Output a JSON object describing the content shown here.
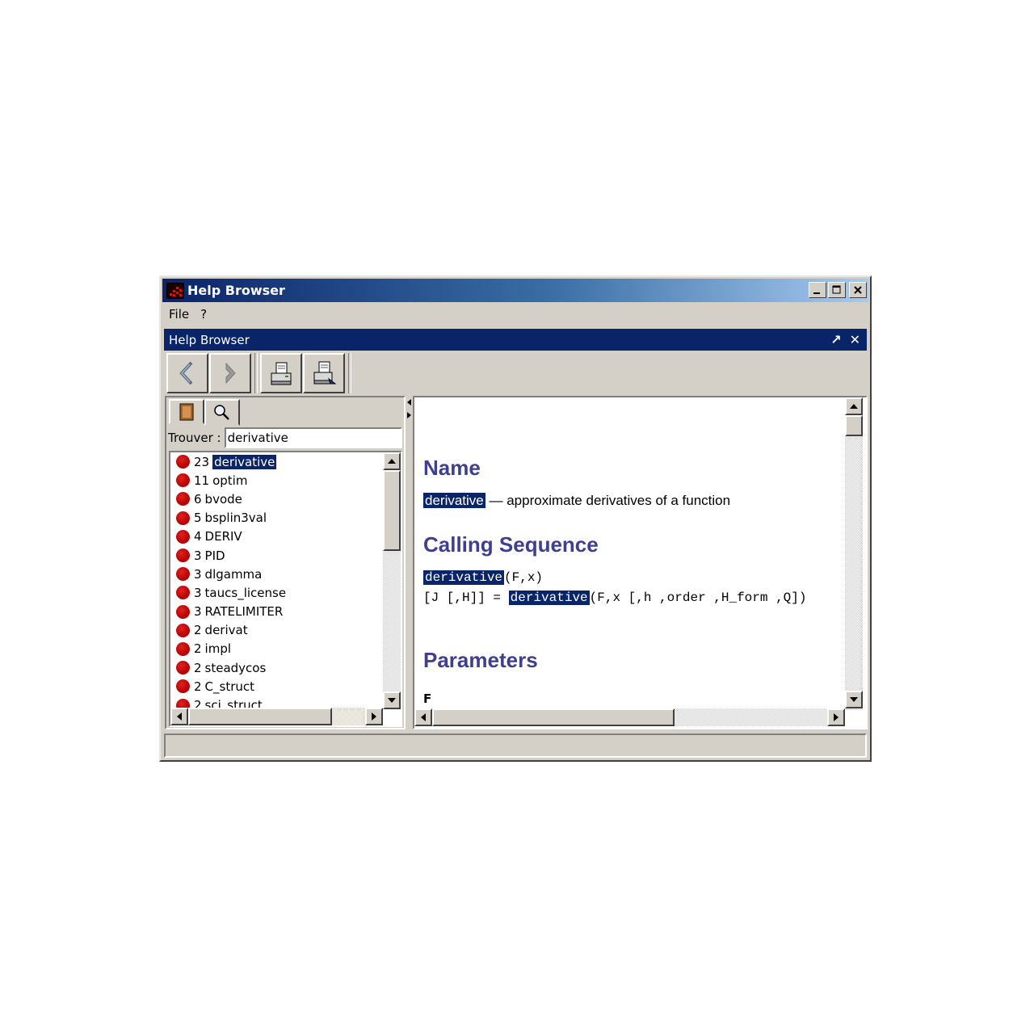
{
  "window": {
    "title": "Help Browser"
  },
  "menu": {
    "items": [
      "File",
      "?"
    ]
  },
  "dock": {
    "title": "Help Browser",
    "undock_glyph": "↗",
    "close_glyph": "✕"
  },
  "toolbar": {
    "buttons": [
      "back-icon",
      "forward-icon",
      "print-setup-icon",
      "print-icon"
    ]
  },
  "search": {
    "label": "Trouver :",
    "value": "derivative"
  },
  "results": [
    {
      "count": "23",
      "name": "derivative",
      "selected": true
    },
    {
      "count": "11",
      "name": "optim"
    },
    {
      "count": "6",
      "name": "bvode"
    },
    {
      "count": "5",
      "name": "bsplin3val"
    },
    {
      "count": "4",
      "name": "DERIV"
    },
    {
      "count": "3",
      "name": "PID"
    },
    {
      "count": "3",
      "name": "dlgamma"
    },
    {
      "count": "3",
      "name": "taucs_license"
    },
    {
      "count": "3",
      "name": "RATELIMITER"
    },
    {
      "count": "2",
      "name": "derivat"
    },
    {
      "count": "2",
      "name": "impl"
    },
    {
      "count": "2",
      "name": "steadycos"
    },
    {
      "count": "2",
      "name": "C_struct"
    },
    {
      "count": "2",
      "name": "sci_struct"
    }
  ],
  "doc": {
    "name_heading": "Name",
    "name_term": "derivative",
    "name_desc": " — approximate derivatives of a function",
    "calling_heading": "Calling Sequence",
    "call1_fn": "derivative",
    "call1_args": "(F,x)",
    "call2_prefix": "[J [,H]] = ",
    "call2_fn": "derivative",
    "call2_args": "(F,x [,h ,order ,H_form ,Q])",
    "params_heading": "Parameters",
    "param1": "F"
  },
  "colors": {
    "title_start": "#0a246a",
    "title_end": "#a6caf0",
    "heading": "#3f3f8f",
    "highlight": "#0a246a",
    "dot": "#cc0000"
  }
}
